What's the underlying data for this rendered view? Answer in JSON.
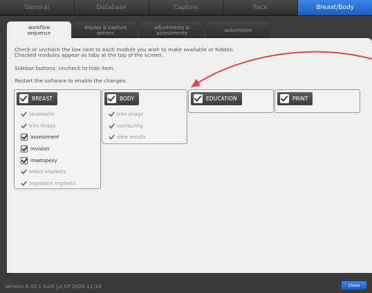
{
  "top_tabs": [
    "General",
    "Database",
    "Capture",
    "Face",
    "Breast/Body"
  ],
  "active_top_tab": "Breast/Body",
  "sub_tabs": [
    "workflow\nsequence",
    "display & capture\noptions",
    "adjustments &\nassessments",
    "automation"
  ],
  "info": {
    "line1": "Check or uncheck the box next to each module you wish to make available or hidden.",
    "line2": "Checked modules appear as tabs at the top of the screen.",
    "line3": "Sidebar buttons: Uncheck to hide item.",
    "line4": "Restart the software to enable the changes."
  },
  "modules": {
    "breast": {
      "title": "BREAST",
      "items": [
        "landmarks",
        "trim image",
        "assessment",
        "revision",
        "mastopexy",
        "select implants",
        "reposition implants"
      ]
    },
    "body": {
      "title": "BODY",
      "items": [
        "trim image",
        "contouring",
        "view results"
      ]
    },
    "education": {
      "title": "EDUCATION"
    },
    "print": {
      "title": "PRINT"
    }
  },
  "status": {
    "version": "Version 6.10.1 built Jul 07 2020 11:19",
    "close_label": "close"
  },
  "colors": {
    "accent": "#2a6fd6",
    "annotation_arrow": "#e0454a"
  }
}
